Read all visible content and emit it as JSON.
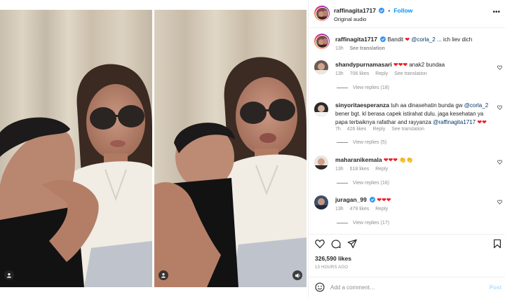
{
  "post": {
    "author": "raffinagita1717",
    "follow_label": "Follow",
    "audio": "Original audio",
    "header_separator": "•",
    "more": "•••"
  },
  "caption": {
    "username": "raffinagita1717",
    "text_before": "Bandit",
    "emoji": "❤",
    "mention": "@corla_2",
    "text_after": "... ich liev dich",
    "time": "13h",
    "see_translation": "See translation"
  },
  "comments": [
    {
      "username": "shandypurnamasari",
      "text": "anak2 bundaa",
      "emoji_prefix": "❤❤❤",
      "time": "13h",
      "likes": "706 likes",
      "reply": "Reply",
      "see_translation": "See translation",
      "view_replies": "View replies (18)"
    },
    {
      "username": "sinyoritaesperanza",
      "text": "tuh aa dinasehatin bunda gw",
      "mention": "@corla_2",
      "text2": "bener bgt. kl berasa capek istirahat dulu. jaga kesehatan ya papa terbaiknya rafathar and rayyanza",
      "mention2": "@raffinagita1717",
      "emoji_suffix": "❤❤",
      "time": "7h",
      "likes": "426 likes",
      "reply": "Reply",
      "see_translation": "See translation",
      "view_replies": "View replies (5)"
    },
    {
      "username": "maharanikemala",
      "emoji": "❤❤❤",
      "emoji_clap": "👏👏",
      "time": "13h",
      "likes": "618 likes",
      "reply": "Reply",
      "view_replies": "View replies (16)"
    },
    {
      "username": "juragan_99",
      "emoji": "❤❤❤",
      "time": "13h",
      "likes": "479 likes",
      "reply": "Reply",
      "view_replies": "View replies (17)"
    }
  ],
  "stats": {
    "likes": "326,590 likes",
    "ago": "13 HOURS AGO"
  },
  "add_comment": {
    "placeholder": "Add a comment…",
    "post_label": "Post"
  },
  "icons": {
    "like": "heart-icon",
    "comment": "comment-icon",
    "share": "share-icon",
    "save": "bookmark-icon",
    "emoji": "emoji-icon",
    "tagged": "person-icon",
    "sound": "speaker-icon"
  },
  "colors": {
    "accent": "#0095f6",
    "heart": "#ed1b24",
    "verified": "#3897f0",
    "muted": "#8e8e8e"
  }
}
